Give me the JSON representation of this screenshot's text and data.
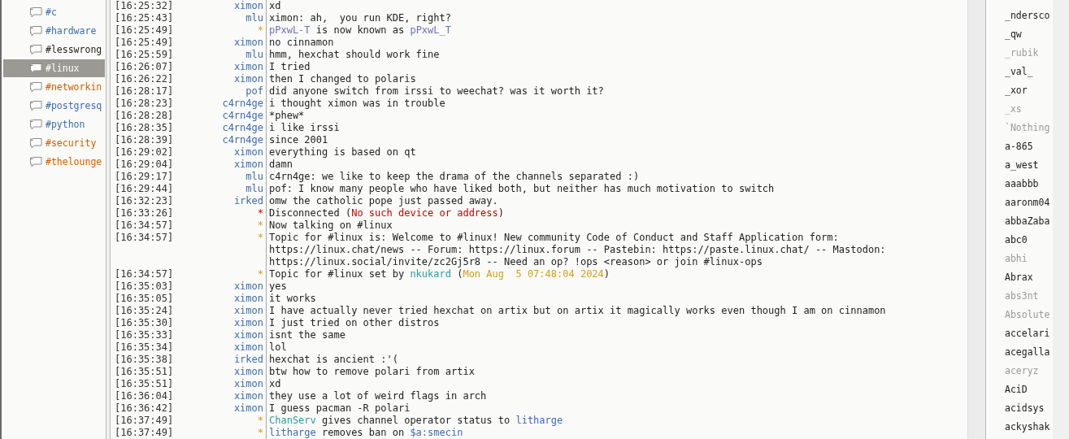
{
  "channels": [
    {
      "name": "#c",
      "color": "#3d6bb3",
      "selected": false
    },
    {
      "name": "#hardware",
      "color": "#3d6bb3",
      "selected": false
    },
    {
      "name": "#lesswrong",
      "color": "#222222",
      "selected": false
    },
    {
      "name": "#linux",
      "color": "#ffffff",
      "selected": true
    },
    {
      "name": "#networkin",
      "color": "#d05e00",
      "selected": false
    },
    {
      "name": "#postgresq",
      "color": "#3d6bb3",
      "selected": false
    },
    {
      "name": "#python",
      "color": "#3d6bb3",
      "selected": false
    },
    {
      "name": "#security",
      "color": "#d05e00",
      "selected": false
    },
    {
      "name": "#thelounge",
      "color": "#d05e00",
      "selected": false
    }
  ],
  "lines": [
    {
      "time": "[16:25:32]",
      "kind": "message",
      "nick": "ximon",
      "segments": [
        {
          "text": "xd"
        }
      ]
    },
    {
      "time": "[16:25:43]",
      "kind": "message",
      "nick": "mlu",
      "segments": [
        {
          "text": "ximon: ah,  you run KDE, right?"
        }
      ]
    },
    {
      "time": "[16:25:49]",
      "kind": "event",
      "nick": "*",
      "segments": [
        {
          "text": "pPxwL-T",
          "color": "#6a70c4"
        },
        {
          "text": " is now known as "
        },
        {
          "text": "pPxwL_T",
          "color": "#6a70c4"
        }
      ]
    },
    {
      "time": "[16:25:49]",
      "kind": "message",
      "nick": "ximon",
      "segments": [
        {
          "text": "no cinnamon"
        }
      ]
    },
    {
      "time": "[16:25:59]",
      "kind": "message",
      "nick": "mlu",
      "segments": [
        {
          "text": "hmm, hexchat should work fine"
        }
      ]
    },
    {
      "time": "[16:26:07]",
      "kind": "message",
      "nick": "ximon",
      "segments": [
        {
          "text": "I tried"
        }
      ]
    },
    {
      "time": "[16:26:22]",
      "kind": "message",
      "nick": "ximon",
      "segments": [
        {
          "text": "then I changed to polaris"
        }
      ]
    },
    {
      "time": "[16:28:17]",
      "kind": "message",
      "nick": "pof",
      "segments": [
        {
          "text": "did anyone switch from irssi to weechat? was it worth it?"
        }
      ]
    },
    {
      "time": "[16:28:23]",
      "kind": "message",
      "nick": "c4rn4ge",
      "segments": [
        {
          "text": "i thought ximon was in trouble"
        }
      ]
    },
    {
      "time": "[16:28:28]",
      "kind": "message",
      "nick": "c4rn4ge",
      "segments": [
        {
          "text": "*phew*"
        }
      ]
    },
    {
      "time": "[16:28:35]",
      "kind": "message",
      "nick": "c4rn4ge",
      "segments": [
        {
          "text": "i like irssi"
        }
      ]
    },
    {
      "time": "[16:28:39]",
      "kind": "message",
      "nick": "c4rn4ge",
      "segments": [
        {
          "text": "since 2001"
        }
      ]
    },
    {
      "time": "[16:29:02]",
      "kind": "message",
      "nick": "ximon",
      "segments": [
        {
          "text": "everything is based on qt"
        }
      ]
    },
    {
      "time": "[16:29:04]",
      "kind": "message",
      "nick": "ximon",
      "segments": [
        {
          "text": "damn"
        }
      ]
    },
    {
      "time": "[16:29:17]",
      "kind": "message",
      "nick": "mlu",
      "segments": [
        {
          "text": "c4rn4ge: we like to keep the drama of the channels separated :)"
        }
      ]
    },
    {
      "time": "[16:29:44]",
      "kind": "message",
      "nick": "mlu",
      "segments": [
        {
          "text": "pof: I know many people who have liked both, but neither has much motivation to switch"
        }
      ]
    },
    {
      "time": "[16:32:23]",
      "kind": "message",
      "nick": "irked",
      "segments": [
        {
          "text": "omw the catholic pope just passed away."
        }
      ]
    },
    {
      "time": "[16:33:26]",
      "kind": "error",
      "nick": "*",
      "segments": [
        {
          "text": "Disconnected ("
        },
        {
          "text": "No such device or address",
          "color": "#cc0000"
        },
        {
          "text": ")"
        }
      ]
    },
    {
      "time": "[16:34:57]",
      "kind": "event",
      "nick": "*",
      "segments": [
        {
          "text": "Now talking on #linux"
        }
      ]
    },
    {
      "time": "[16:34:57]",
      "kind": "event",
      "nick": "*",
      "segments": [
        {
          "text": "Topic for #linux is: Welcome to #linux! New community Code of Conduct and Staff Application form: https://linux.chat/news -- Forum: https://linux.forum -- Pastebin: https://paste.linux.chat/ -- Mastodon: https://linux.social/invite/zc2Gj5r8 -- Need an op? !ops <reason> or join #linux-ops"
        }
      ]
    },
    {
      "time": "[16:34:57]",
      "kind": "event",
      "nick": "*",
      "segments": [
        {
          "text": "Topic for #linux set by "
        },
        {
          "text": "nkukard",
          "color": "#2a9d9d"
        },
        {
          "text": " ("
        },
        {
          "text": "Mon Aug  5 07:48:04 2024",
          "color": "#d4a017"
        },
        {
          "text": ")"
        }
      ]
    },
    {
      "time": "[16:35:03]",
      "kind": "message",
      "nick": "ximon",
      "segments": [
        {
          "text": "yes"
        }
      ]
    },
    {
      "time": "[16:35:05]",
      "kind": "message",
      "nick": "ximon",
      "segments": [
        {
          "text": "it works"
        }
      ]
    },
    {
      "time": "[16:35:24]",
      "kind": "message",
      "nick": "ximon",
      "segments": [
        {
          "text": "I have actually never tried hexchat on artix but on artix it magically works even though I am on cinnamon"
        }
      ]
    },
    {
      "time": "[16:35:30]",
      "kind": "message",
      "nick": "ximon",
      "segments": [
        {
          "text": "I just tried on other distros"
        }
      ]
    },
    {
      "time": "[16:35:33]",
      "kind": "message",
      "nick": "ximon",
      "segments": [
        {
          "text": "isnt the same"
        }
      ]
    },
    {
      "time": "[16:35:34]",
      "kind": "message",
      "nick": "ximon",
      "segments": [
        {
          "text": "lol"
        }
      ]
    },
    {
      "time": "[16:35:38]",
      "kind": "message",
      "nick": "irked",
      "segments": [
        {
          "text": "hexchat is ancient :'("
        }
      ]
    },
    {
      "time": "[16:35:51]",
      "kind": "message",
      "nick": "ximon",
      "segments": [
        {
          "text": "btw how to remove polari from artix"
        }
      ]
    },
    {
      "time": "[16:35:51]",
      "kind": "message",
      "nick": "ximon",
      "segments": [
        {
          "text": "xd"
        }
      ]
    },
    {
      "time": "[16:36:04]",
      "kind": "message",
      "nick": "ximon",
      "segments": [
        {
          "text": "they use a lot of weird flags in arch"
        }
      ]
    },
    {
      "time": "[16:36:42]",
      "kind": "message",
      "nick": "ximon",
      "segments": [
        {
          "text": "I guess pacman -R polari"
        }
      ]
    },
    {
      "time": "[16:37:49]",
      "kind": "event",
      "nick": "*",
      "segments": [
        {
          "text": "ChanServ",
          "color": "#2a9d9d"
        },
        {
          "text": " gives channel operator status to "
        },
        {
          "text": "litharge",
          "color": "#3d6bb3"
        }
      ]
    },
    {
      "time": "[16:37:49]",
      "kind": "event",
      "nick": "*",
      "segments": [
        {
          "text": "litharge",
          "color": "#3d6bb3"
        },
        {
          "text": " removes ban on "
        },
        {
          "text": "$a:smecin",
          "color": "#3d6bb3"
        }
      ]
    }
  ],
  "users": [
    {
      "name": "_ndersco",
      "away": false
    },
    {
      "name": "_qw",
      "away": false
    },
    {
      "name": "_rubik",
      "away": true
    },
    {
      "name": "_val_",
      "away": false
    },
    {
      "name": "_xor",
      "away": false
    },
    {
      "name": "_xs",
      "away": true
    },
    {
      "name": "`Nothing",
      "away": true
    },
    {
      "name": "a-865",
      "away": false
    },
    {
      "name": "a_west",
      "away": false
    },
    {
      "name": "aaabbb",
      "away": false
    },
    {
      "name": "aaronm04",
      "away": false
    },
    {
      "name": "abbaZaba",
      "away": false
    },
    {
      "name": "abc0",
      "away": false
    },
    {
      "name": "abhi",
      "away": true
    },
    {
      "name": "Abrax",
      "away": false
    },
    {
      "name": "abs3nt",
      "away": true
    },
    {
      "name": "Absolute",
      "away": true
    },
    {
      "name": "accelari",
      "away": false
    },
    {
      "name": "acegalla",
      "away": false
    },
    {
      "name": "aceryz",
      "away": true
    },
    {
      "name": "AciD",
      "away": false
    },
    {
      "name": "acidsys",
      "away": false
    },
    {
      "name": "ackyshak",
      "away": false
    }
  ]
}
